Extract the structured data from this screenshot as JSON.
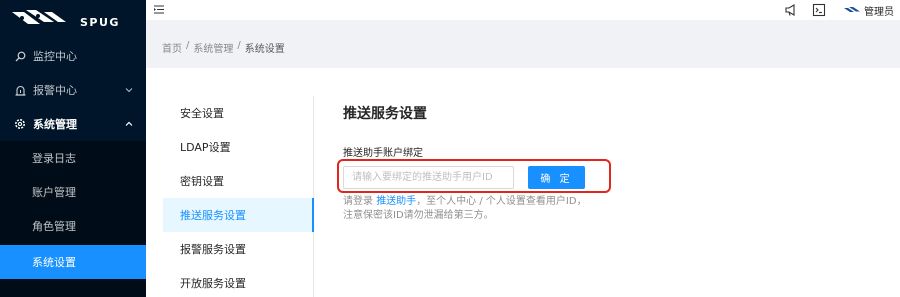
{
  "brand": {
    "name": "SPUG"
  },
  "sidebar": {
    "items": [
      {
        "label": "监控中心",
        "icon": "monitor-icon"
      },
      {
        "label": "报警中心",
        "icon": "alarm-icon"
      },
      {
        "label": "系统管理",
        "icon": "settings-icon"
      }
    ],
    "submenu": [
      {
        "label": "登录日志"
      },
      {
        "label": "账户管理"
      },
      {
        "label": "角色管理"
      },
      {
        "label": "系统设置"
      }
    ]
  },
  "header": {
    "user": "管理员",
    "icons": [
      "notification-icon",
      "terminal-icon",
      "avatar-icon"
    ]
  },
  "breadcrumb": {
    "items": [
      "首页",
      "系统管理",
      "系统设置"
    ],
    "separator": "/"
  },
  "settings_nav": {
    "items": [
      {
        "label": "安全设置"
      },
      {
        "label": "LDAP设置"
      },
      {
        "label": "密钥设置"
      },
      {
        "label": "推送服务设置"
      },
      {
        "label": "报警服务设置"
      },
      {
        "label": "开放服务设置"
      }
    ]
  },
  "panel": {
    "title": "推送服务设置",
    "field_label": "推送助手账户绑定",
    "input_placeholder": "请输入要绑定的推送助手用户ID",
    "input_value": "",
    "confirm_label": "确 定",
    "help_prefix": "请登录",
    "help_link": "推送助手",
    "help_suffix": "，至个人中心 / 个人设置查看用户ID，注意保密该ID请勿泄漏给第三方。"
  },
  "colors": {
    "accent": "#1890ff",
    "sidebar_bg": "#001529",
    "highlight": "#e0271e"
  }
}
